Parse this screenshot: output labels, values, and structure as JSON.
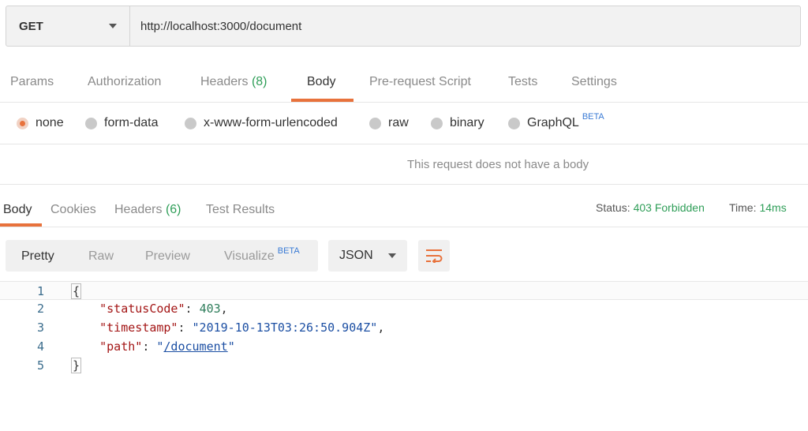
{
  "request": {
    "method": "GET",
    "url": "http://localhost:3000/document"
  },
  "request_tabs": {
    "params": "Params",
    "authorization": "Authorization",
    "headers": "Headers",
    "headers_count": "(8)",
    "body": "Body",
    "prerequest": "Pre-request Script",
    "tests": "Tests",
    "settings": "Settings"
  },
  "body_types": {
    "none": "none",
    "form_data": "form-data",
    "urlencoded": "x-www-form-urlencoded",
    "raw": "raw",
    "binary": "binary",
    "graphql": "GraphQL",
    "graphql_badge": "BETA"
  },
  "no_body_message": "This request does not have a body",
  "response_tabs": {
    "body": "Body",
    "cookies": "Cookies",
    "headers": "Headers",
    "headers_count": "(6)",
    "test_results": "Test Results"
  },
  "response_status": {
    "status_label": "Status:",
    "status_value": "403 Forbidden",
    "time_label": "Time:",
    "time_value": "14ms"
  },
  "view_modes": {
    "pretty": "Pretty",
    "raw": "Raw",
    "preview": "Preview",
    "visualize": "Visualize",
    "visualize_badge": "BETA"
  },
  "format": "JSON",
  "code": {
    "line_numbers": [
      "1",
      "2",
      "3",
      "4",
      "5"
    ],
    "open_brace": "{",
    "close_brace": "}",
    "entries": [
      {
        "key": "\"statusCode\"",
        "sep": ": ",
        "value": "403",
        "trail": ","
      },
      {
        "key": "\"timestamp\"",
        "sep": ": ",
        "value": "\"2019-10-13T03:26:50.904Z\"",
        "trail": ","
      },
      {
        "key": "\"path\"",
        "sep": ": ",
        "q1": "\"",
        "value": "/document",
        "q2": "\""
      }
    ]
  },
  "colors": {
    "accent": "#e8723c",
    "success": "#2f9e58",
    "beta": "#3a7bd5"
  },
  "icons": {
    "method_dropdown": "caret-down-icon",
    "format_dropdown": "caret-down-icon",
    "wrap": "wrap-lines-icon"
  }
}
